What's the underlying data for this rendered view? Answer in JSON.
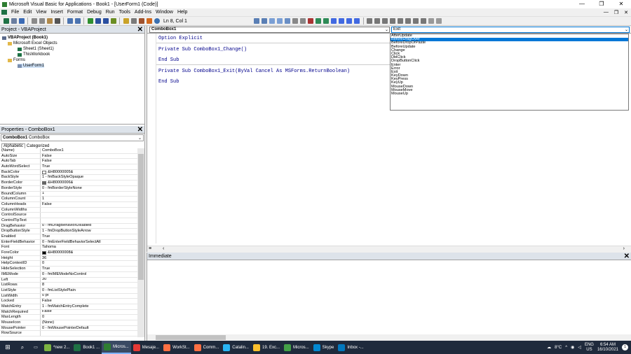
{
  "window": {
    "title": "Microsoft Visual Basic for Applications - Book1 - [UserForm1 (Code)]",
    "controls": [
      "—",
      "❐",
      "✕"
    ]
  },
  "menu": {
    "items": [
      "File",
      "Edit",
      "View",
      "Insert",
      "Format",
      "Debug",
      "Run",
      "Tools",
      "Add-Ins",
      "Window",
      "Help"
    ],
    "right_controls": [
      "—",
      "❐",
      "✕"
    ]
  },
  "toolbar": {
    "location": "Ln 8, Col 1"
  },
  "project": {
    "title": "Project - VBAProject",
    "close": "✕",
    "tree": [
      {
        "label": "VBAProject (Book1)",
        "bold": true,
        "indent": 0
      },
      {
        "label": "Microsoft Excel Objects",
        "indent": 1
      },
      {
        "label": "Sheet1 (Sheet1)",
        "indent": 2
      },
      {
        "label": "ThisWorkbook",
        "indent": 2
      },
      {
        "label": "Forms",
        "indent": 1
      },
      {
        "label": "UserForm1",
        "indent": 2,
        "selected": true
      }
    ]
  },
  "properties": {
    "title": "Properties - ComboBox1",
    "close": "✕",
    "object": "ComboBox1",
    "object_type": "ComboBox",
    "tabs": [
      "Alphabetic",
      "Categorized"
    ],
    "rows": [
      [
        "(Name)",
        "ComboBox1"
      ],
      [
        "AutoSize",
        "False"
      ],
      [
        "AutoTab",
        "False"
      ],
      [
        "AutoWordSelect",
        "True"
      ],
      [
        "BackColor",
        "&H80000005&"
      ],
      [
        "BackStyle",
        "1 - fmBackStyleOpaque"
      ],
      [
        "BorderColor",
        "&H80000006&"
      ],
      [
        "BorderStyle",
        "0 - fmBorderStyleNone"
      ],
      [
        "BoundColumn",
        "1"
      ],
      [
        "ColumnCount",
        "1"
      ],
      [
        "ColumnHeads",
        "False"
      ],
      [
        "ColumnWidths",
        ""
      ],
      [
        "ControlSource",
        ""
      ],
      [
        "ControlTipText",
        ""
      ],
      [
        "DragBehavior",
        "0 - fmDragBehaviorDisabled"
      ],
      [
        "DropButtonStyle",
        "1 - fmDropButtonStyleArrow"
      ],
      [
        "Enabled",
        "True"
      ],
      [
        "EnterFieldBehavior",
        "0 - fmEnterFieldBehaviorSelectAll"
      ],
      [
        "Font",
        "Tahoma"
      ],
      [
        "ForeColor",
        "&H80000008&"
      ],
      [
        "Height",
        "36"
      ],
      [
        "HelpContextID",
        "0"
      ],
      [
        "HideSelection",
        "True"
      ],
      [
        "IMEMode",
        "0 - fmIMEModeNoControl"
      ],
      [
        "Left",
        "30"
      ],
      [
        "ListRows",
        "8"
      ],
      [
        "ListStyle",
        "0 - fmListStylePlain"
      ],
      [
        "ListWidth",
        "0 pt"
      ],
      [
        "Locked",
        "False"
      ],
      [
        "MatchEntry",
        "1 - fmMatchEntryComplete"
      ],
      [
        "MatchRequired",
        "False"
      ],
      [
        "MaxLength",
        "0"
      ],
      [
        "MouseIcon",
        "(None)"
      ],
      [
        "MousePointer",
        "0 - fmMousePointerDefault"
      ],
      [
        "RowSource",
        ""
      ]
    ]
  },
  "code": {
    "object_combo": "ComboBox1",
    "proc_combo": "Exit",
    "lines": [
      "Option Explicit",
      "Private Sub ComboBox1_Change()",
      "End Sub",
      "Private Sub ComboBox1_Exit(ByVal Cancel As MSForms.ReturnBoolean)",
      "End Sub"
    ],
    "dropdown": [
      "AfterUpdate",
      "BeforeDragOver",
      "BeforeDropOrPaste",
      "BeforeUpdate",
      "Change",
      "Click",
      "DblClick",
      "DropButtonClick",
      "Enter",
      "Error",
      "Exit",
      "KeyDown",
      "KeyPress",
      "KeyUp",
      "MouseDown",
      "MouseMove",
      "MouseUp"
    ],
    "dropdown_highlight": "BeforeDragOver"
  },
  "immediate": {
    "title": "Immediate",
    "close": "✕"
  },
  "taskbar": {
    "items": [
      {
        "label": "*new 2...",
        "color": "#7cb342"
      },
      {
        "label": "Book1 ...",
        "color": "#1e7145"
      },
      {
        "label": "Micros...",
        "color": "#2e7d32",
        "active": true
      },
      {
        "label": "Mesaje...",
        "color": "#e53935"
      },
      {
        "label": "WorkSt...",
        "color": "#ff7043"
      },
      {
        "label": "Comm...",
        "color": "#ff7043"
      },
      {
        "label": "Catalin...",
        "color": "#29b6f6"
      },
      {
        "label": "19. Exc...",
        "color": "#fbc02d"
      },
      {
        "label": "Micros...",
        "color": "#43a047"
      },
      {
        "label": "Skype",
        "color": "#0288d1"
      },
      {
        "label": "Inbox -...",
        "color": "#0277bd"
      }
    ],
    "weather": "8°C",
    "lang": [
      "ENG",
      "US"
    ],
    "time": "6:54 AM",
    "date": "16/10/2021",
    "notif": "1"
  }
}
